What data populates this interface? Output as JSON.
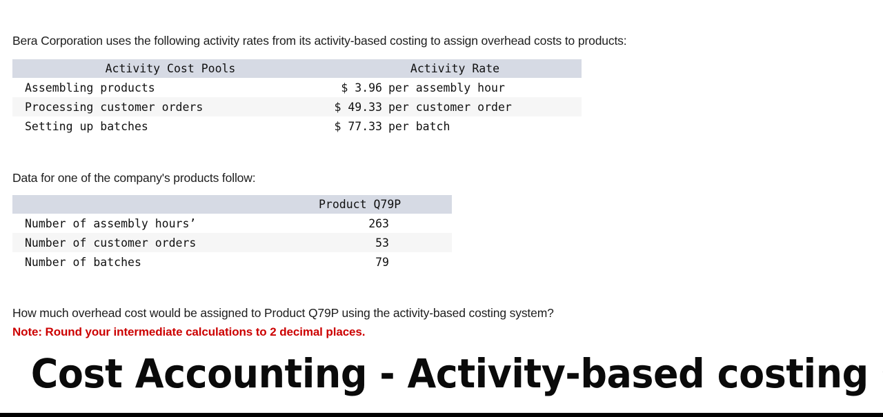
{
  "intro_text": "Bera Corporation uses the following activity rates from its activity-based costing to assign overhead costs to products:",
  "data_lead_text": "Data for one of the company's products follow:",
  "question_text": "How much overhead cost would be assigned to Product Q79P using the activity-based costing system?",
  "note_text": "Note: Round your intermediate calculations to 2 decimal places.",
  "banner_title": "Cost Accounting - Activity-based costing system",
  "activity_rate_table": {
    "headers": {
      "pool": "Activity Cost Pools",
      "rate": "Activity Rate"
    },
    "rows": [
      {
        "pool": "Assembling products",
        "rate_amount": "$ 3.96",
        "rate_unit": "per assembly hour",
        "rate_full": "$ 3.96 per assembly hour"
      },
      {
        "pool": "Processing customer orders",
        "rate_amount": "$ 49.33",
        "rate_unit": "per customer order",
        "rate_full": "$ 49.33 per customer order"
      },
      {
        "pool": "Setting up batches",
        "rate_amount": "$ 77.33",
        "rate_unit": "per batch",
        "rate_full": "$ 77.33 per batch"
      }
    ]
  },
  "product_data_table": {
    "headers": {
      "blank": "",
      "product": "Product Q79P"
    },
    "rows": [
      {
        "label": "Number of assembly hours’",
        "value": "263"
      },
      {
        "label": "Number of customer orders",
        "value": "53"
      },
      {
        "label": "Number of batches",
        "value": "79"
      }
    ]
  },
  "colors": {
    "table_header_band": "#d6dae4",
    "row_alt_shade": "#f6f6f6",
    "note_red": "#cc0000",
    "text": "#1d1d1d",
    "bottom_bar": "#000000"
  }
}
